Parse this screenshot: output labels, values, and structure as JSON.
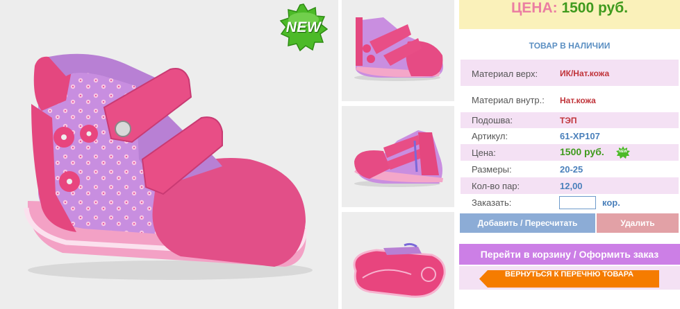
{
  "badge": {
    "text": "NEW"
  },
  "price_banner": {
    "label": "ЦЕНА:",
    "value": "1500 руб."
  },
  "availability": "ТОВАР В НАЛИЧИИ",
  "specs": {
    "upper": {
      "label": "Материал верх:",
      "value": "ИК/Нат.кожа"
    },
    "lining": {
      "label": "Материал внутр.:",
      "value": "Нат.кожа"
    },
    "sole": {
      "label": "Подошва:",
      "value": "ТЭП"
    },
    "article": {
      "label": "Артикул:",
      "value": "61-XP107"
    },
    "price": {
      "label": "Цена:",
      "value": "1500 руб.",
      "badge": "NEW"
    },
    "sizes": {
      "label": "Размеры:",
      "value": "20-25"
    },
    "pairs": {
      "label": "Кол-во пар:",
      "value": "12,00"
    },
    "order": {
      "label": "Заказать:",
      "input_value": "",
      "unit": "кор."
    }
  },
  "buttons": {
    "add": "Добавить / Пересчитать",
    "delete": "Удалить",
    "cart": "Перейти в корзину / Оформить заказ",
    "back": "ВЕРНУТЬСЯ К ПЕРЕЧНЮ ТОВАРА"
  },
  "colors": {
    "price_label": "#eb7ea2",
    "price_value": "#3f9a1d",
    "spec_value_red": "#c0343a",
    "spec_value_blue": "#4a80bb",
    "shade_row": "#f4e1f4",
    "banner_bg": "#faf1ba",
    "cart_button": "#cc7fe6",
    "back_button": "#f57c00"
  },
  "icons": [
    "new-badge-icon",
    "shoe-photo",
    "shoe-thumb-front",
    "shoe-thumb-side",
    "shoe-thumb-sole"
  ]
}
